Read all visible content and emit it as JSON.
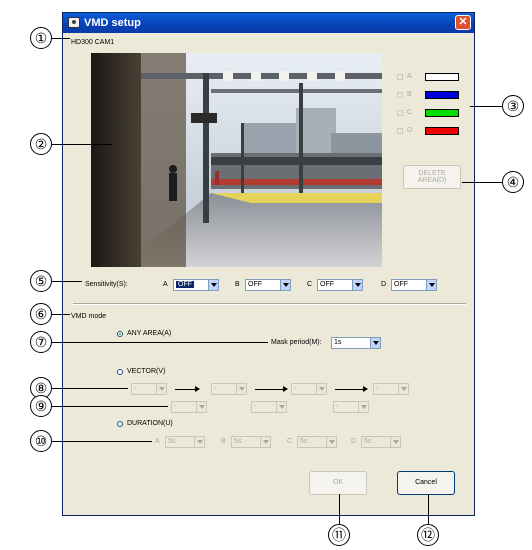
{
  "dialog": {
    "title": "VMD setup",
    "close_glyph": "✕"
  },
  "camera_name": "HD300 CAM1",
  "area_list": [
    {
      "letter": "A",
      "color": "#ffffff"
    },
    {
      "letter": "B",
      "color": "#0000dd"
    },
    {
      "letter": "C",
      "color": "#00dd00"
    },
    {
      "letter": "D",
      "color": "#ee0000"
    }
  ],
  "delete_area_button": {
    "line1": "DELETE",
    "line2": "AREA(D)"
  },
  "sensitivity": {
    "label": "Sensitivity(S):",
    "areas": [
      {
        "letter": "A",
        "value": "OFF"
      },
      {
        "letter": "B",
        "value": "OFF"
      },
      {
        "letter": "C",
        "value": "OFF"
      },
      {
        "letter": "D",
        "value": "OFF"
      }
    ]
  },
  "vmd_mode": {
    "label": "VMD mode",
    "any_area": "ANY AREA(A)",
    "mask_period_label": "Mask period(M):",
    "mask_period_value": "1s",
    "vector": "VECTOR(V)",
    "vector_values": [
      "-",
      "-",
      "-",
      "-"
    ],
    "vector_sub_values": [
      "-",
      "-",
      "-"
    ],
    "duration": "DURATION(U)",
    "duration_areas": [
      {
        "letter": "A",
        "value": "5s"
      },
      {
        "letter": "B",
        "value": "5s"
      },
      {
        "letter": "C",
        "value": "5s"
      },
      {
        "letter": "D",
        "value": "5s"
      }
    ]
  },
  "buttons": {
    "ok": "OK",
    "cancel": "Cancel"
  },
  "callouts": [
    "①",
    "②",
    "③",
    "④",
    "⑤",
    "⑥",
    "⑦",
    "⑧",
    "⑨",
    "⑩",
    "⑪",
    "⑫"
  ]
}
